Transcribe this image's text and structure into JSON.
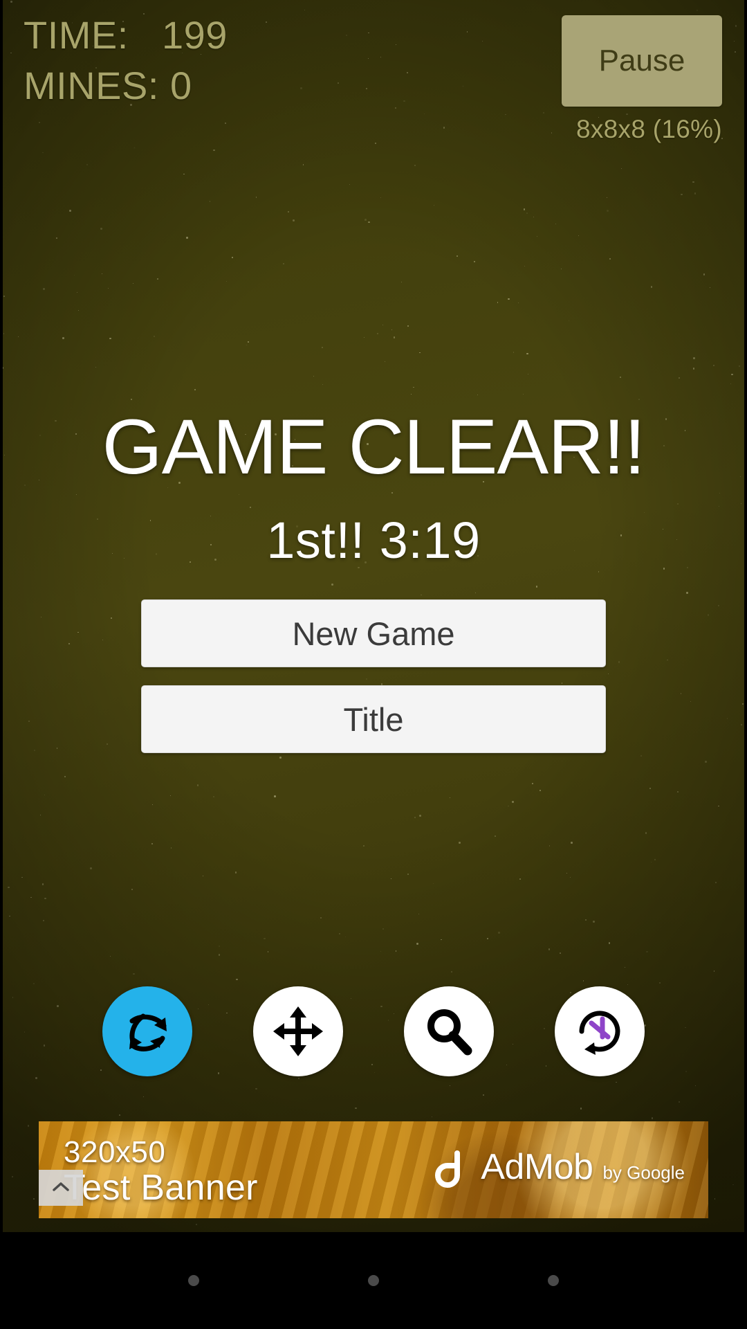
{
  "hud": {
    "time_line": "TIME:   199",
    "mines_line": "MINES: 0",
    "pause_label": "Pause",
    "difficulty": "8x8x8 (16%)",
    "text_color": "#a8a46a",
    "pause_bg": "#a9a476"
  },
  "result": {
    "title": "GAME CLEAR!!",
    "score": "1st!! 3:19",
    "title_color": "#ffffff",
    "buttons": [
      {
        "id": "new-game",
        "label": "New Game"
      },
      {
        "id": "title",
        "label": "Title"
      }
    ]
  },
  "tools": [
    {
      "id": "rotate-axes",
      "icon": "rotate-axes-icon",
      "active": true,
      "accent": "#24b2ea"
    },
    {
      "id": "pan",
      "icon": "move-arrows-icon",
      "active": false,
      "accent": "#ffffff"
    },
    {
      "id": "zoom",
      "icon": "magnifier-icon",
      "active": false,
      "accent": "#ffffff"
    },
    {
      "id": "undo-rotate",
      "icon": "undo-rotate-icon",
      "active": false,
      "accent": "#8e44c8"
    }
  ],
  "ad": {
    "size_text": "320x50",
    "label_text": "Test Banner",
    "brand_name": "AdMob",
    "brand_by": "by Google",
    "collapse_icon": "chevron-up-icon"
  },
  "nav": {
    "items": [
      {
        "id": "back",
        "icon": "dot-icon"
      },
      {
        "id": "home",
        "icon": "dot-icon"
      },
      {
        "id": "recents",
        "icon": "dot-icon"
      }
    ]
  }
}
